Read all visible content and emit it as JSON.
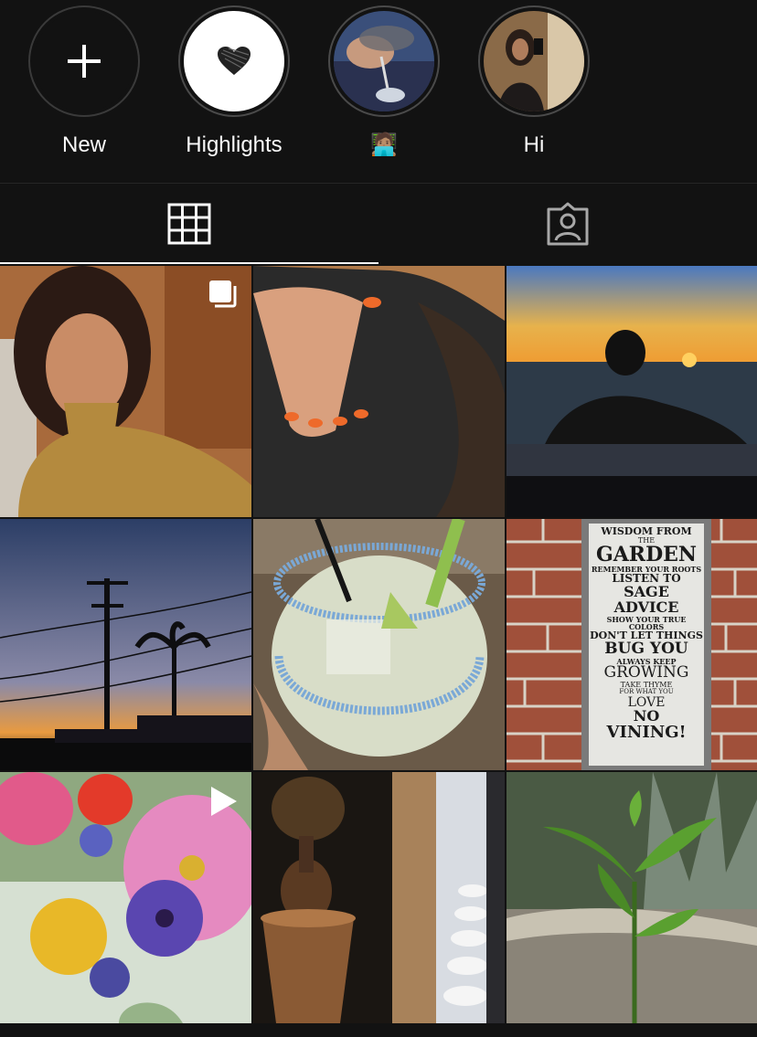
{
  "highlights": [
    {
      "label": "New",
      "icon": "plus-icon"
    },
    {
      "label": "Highlights",
      "icon": "heart-icon"
    },
    {
      "label": "🧑🏽‍💻",
      "icon": "wineglass-photo"
    },
    {
      "label": "Hi",
      "icon": "mirror-selfie-photo"
    }
  ],
  "tabs": [
    {
      "name": "grid",
      "icon": "grid-icon",
      "active": true
    },
    {
      "name": "tagged",
      "icon": "tagged-person-icon",
      "active": false
    }
  ],
  "posts": [
    {
      "subject": "selfie in mustard turtleneck",
      "badge": "carousel-icon"
    },
    {
      "subject": "hand with orange nails",
      "badge": ""
    },
    {
      "subject": "sunset over ocean",
      "badge": ""
    },
    {
      "subject": "power line at dusk with palm trees",
      "badge": ""
    },
    {
      "subject": "margarita with salted rim",
      "badge": ""
    },
    {
      "subject": "garden sign on brick wall",
      "badge": ""
    },
    {
      "subject": "cosmos and cornflower bouquet",
      "badge": "play-icon"
    },
    {
      "subject": "incense burner and cups",
      "badge": ""
    },
    {
      "subject": "tomato seedling in planter",
      "badge": ""
    }
  ],
  "sign": {
    "lines": [
      "WISDOM FROM",
      "THE",
      "GARDEN",
      "REMEMBER YOUR ROOTS",
      "LISTEN TO",
      "SAGE ADVICE",
      "SHOW YOUR TRUE COLORS",
      "DON'T LET THINGS",
      "BUG YOU",
      "ALWAYS KEEP",
      "GROWING",
      "TAKE THYME",
      "FOR WHAT YOU",
      "LOVE",
      "NO",
      "VINING!"
    ]
  },
  "colors": {
    "background": "#121212",
    "text": "#fafafa",
    "ring": "#4a4a4a"
  }
}
